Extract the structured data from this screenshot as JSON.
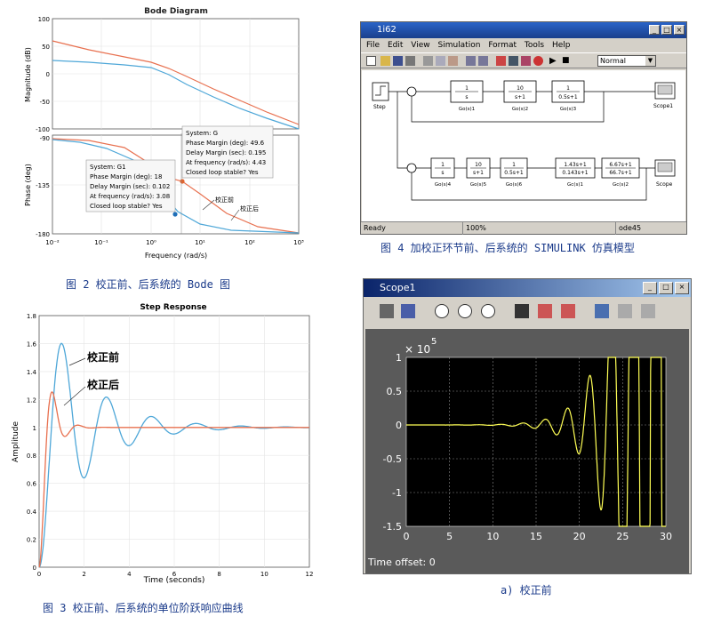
{
  "bode": {
    "title": "Bode Diagram",
    "ylabel_mag": "Magnitude (dB)",
    "ylabel_phase": "Phase (deg)",
    "xlabel": "Frequency  (rad/s)",
    "mag_ticks": [
      "100",
      "50",
      "0",
      "-50",
      "-100"
    ],
    "phase_ticks": [
      "-90",
      "-135",
      "-180"
    ],
    "freq_ticks": [
      "10⁻²",
      "10⁻¹",
      "10⁰",
      "10¹",
      "10²",
      "10³"
    ],
    "tip_g": [
      "System: G",
      "Phase Margin (deg): 49.6",
      "Delay Margin (sec): 0.195",
      "At frequency (rad/s): 4.43",
      "Closed loop stable? Yes"
    ],
    "tip_g1": [
      "System: G1",
      "Phase Margin (deg): 18",
      "Delay Margin (sec): 0.102",
      "At frequency (rad/s): 3.08",
      "Closed loop stable? Yes"
    ],
    "ann_before": "校正前",
    "ann_after": "校正后"
  },
  "caption2": "图 2 校正前、后系统的 Bode 图",
  "step": {
    "title": "Step Response",
    "ylabel": "Amplitude",
    "xlabel": "Time (seconds)",
    "yticks": [
      "0",
      "0.2",
      "0.4",
      "0.6",
      "0.8",
      "1",
      "1.2",
      "1.4",
      "1.6",
      "1.8"
    ],
    "xticks": [
      "0",
      "2",
      "4",
      "6",
      "8",
      "10",
      "12"
    ],
    "ann_before": "校正前",
    "ann_after": "校正后"
  },
  "caption3": "图 3 校正前、后系统的单位阶跃响应曲线",
  "simulink": {
    "title": "1i62",
    "menu": [
      "File",
      "Edit",
      "View",
      "Simulation",
      "Format",
      "Tools",
      "Help"
    ],
    "mode": "Normal",
    "status": [
      "Ready",
      "100%",
      "ode45"
    ],
    "step_label": "Step",
    "scope1": "Scope1",
    "scope": "Scope",
    "row1": [
      {
        "num": "1",
        "den": "s",
        "label": "Go(s)1"
      },
      {
        "num": "10",
        "den": "s+1",
        "label": "Go(s)2"
      },
      {
        "num": "1",
        "den": "0.5s+1",
        "label": "Go(s)3"
      }
    ],
    "row2": [
      {
        "num": "1",
        "den": "s",
        "label": "Go(s)4"
      },
      {
        "num": "10",
        "den": "s+1",
        "label": "Go(s)5"
      },
      {
        "num": "1",
        "den": "0.5s+1",
        "label": "Go(s)6"
      },
      {
        "num": "1.43s+1",
        "den": "0.143s+1",
        "label": "Gc(s)1"
      },
      {
        "num": "6.67s+1",
        "den": "66.7s+1",
        "label": "Gc(s)2"
      }
    ]
  },
  "caption4": "图 4 加校正环节前、后系统的 SIMULINK 仿真模型",
  "scope": {
    "title": "Scope1",
    "exponent": "5",
    "yticks": [
      "1",
      "0.5",
      "0",
      "-0.5",
      "-1",
      "-1.5"
    ],
    "xticks": [
      "0",
      "5",
      "10",
      "15",
      "20",
      "25",
      "30"
    ],
    "offset": "Time offset:  0"
  },
  "caption_a": "a) 校正前"
}
